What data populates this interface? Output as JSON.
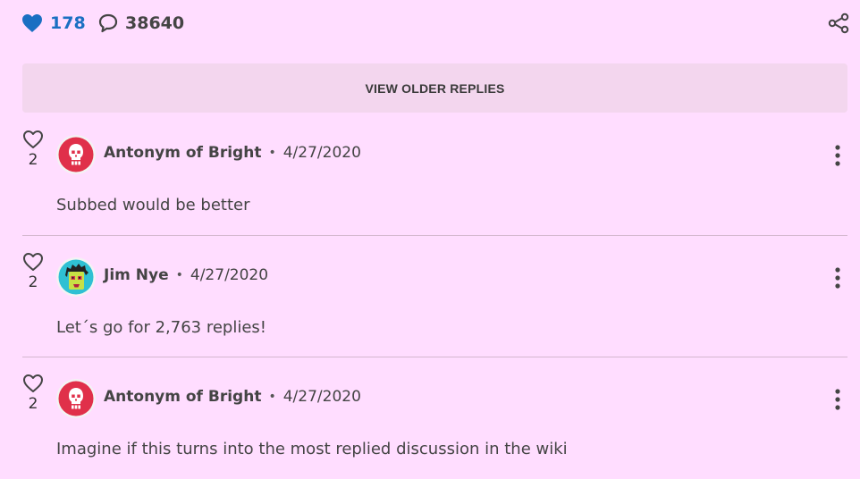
{
  "stats": {
    "likes": "178",
    "comments": "38640"
  },
  "view_older_label": "VIEW OLDER REPLIES",
  "colors": {
    "background": "#ffddff",
    "likes_accent": "#1a6fc2",
    "button_bg": "#f3d6ee",
    "divider": "#d4b8cf"
  },
  "comments": [
    {
      "likes": "2",
      "author": "Antonym of Bright",
      "separator": "•",
      "date": "4/27/2020",
      "text": "Subbed would be better",
      "avatar": "skull-avatar"
    },
    {
      "likes": "2",
      "author": "Jim Nye",
      "separator": "•",
      "date": "4/27/2020",
      "text": "Let´s go for 2,763 replies!",
      "avatar": "face-avatar"
    },
    {
      "likes": "2",
      "author": "Antonym of Bright",
      "separator": "•",
      "date": "4/27/2020",
      "text": "Imagine if this turns into the most replied discussion in the wiki",
      "avatar": "skull-avatar"
    }
  ],
  "icons": {
    "likes": "heart-filled-icon",
    "comments": "speech-bubble-icon",
    "share": "share-icon",
    "like": "heart-outline-icon",
    "more": "more-vertical-icon"
  }
}
